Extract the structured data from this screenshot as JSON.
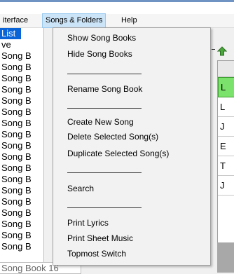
{
  "menubar": {
    "items": [
      {
        "label": "iterface"
      },
      {
        "label": "Songs & Folders"
      },
      {
        "label": "Help"
      }
    ]
  },
  "left_list": {
    "items": [
      "List",
      "ve",
      "Song B",
      "Song B",
      "Song B",
      "Song B",
      "Song B",
      "Song B",
      "Song B",
      "Song B",
      "Song B",
      "Song B",
      "Song B",
      "Song B",
      "Song B",
      "Song B",
      "Song B",
      "Song B",
      "Song B",
      "Song B"
    ],
    "last_item": "Song Book 16"
  },
  "dropdown": {
    "show_song_books": "Show Song Books",
    "hide_song_books": "Hide Song Books",
    "rename_song_book": "Rename Song Book",
    "create_new_song": "Create New Song",
    "delete_selected": "Delete Selected Song(s)",
    "duplicate_selected": "Duplicate Selected Song(s)",
    "search": "Search",
    "print_lyrics": "Print Lyrics",
    "print_sheet_music": "Print Sheet Music",
    "topmost_switch": "Topmost Switch"
  },
  "grid": {
    "rows": [
      "L",
      "L",
      "J",
      "E",
      "T",
      "J"
    ]
  },
  "colors": {
    "selection_blue": "#0a64d8",
    "menu_highlight": "#cce4f7",
    "row_green": "#7be36b"
  }
}
